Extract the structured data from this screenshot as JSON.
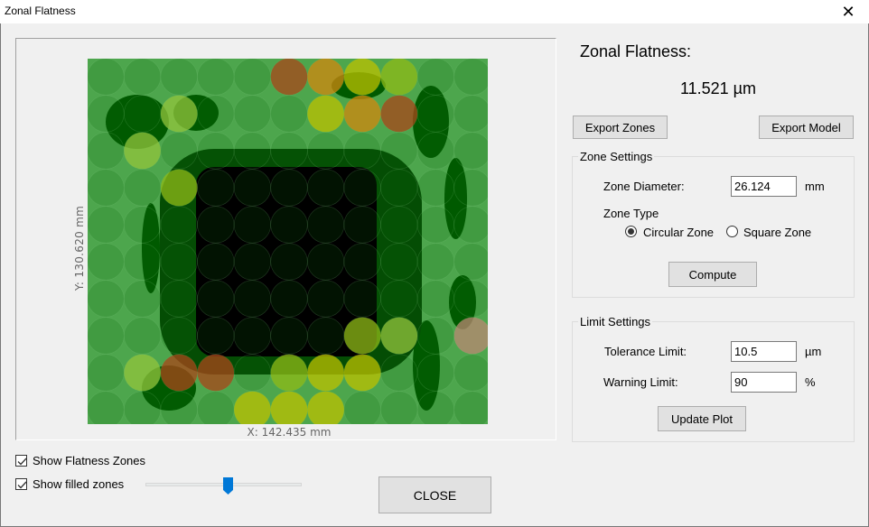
{
  "window": {
    "title": "Zonal Flatness",
    "close_glyph": "✕"
  },
  "plot": {
    "y_label": "Y:  130.620 mm",
    "x_label": "X:  142.435 mm",
    "colors": {
      "flat_light": "#4da64d",
      "flat_dark": "#005a00",
      "center": "#000000",
      "ok_zone": "#0a5f0a",
      "near_warning_zone": "#9acd32",
      "warning_zone": "#c8c800",
      "over_tolerance_zone": "#d2691e",
      "pink_zone": "#d48a8a"
    },
    "zones": [
      {
        "col": 6,
        "row": 1,
        "status": "red"
      },
      {
        "col": 7,
        "row": 1,
        "status": "orange"
      },
      {
        "col": 8,
        "row": 1,
        "status": "yellow"
      },
      {
        "col": 9,
        "row": 1,
        "status": "yellowgreen"
      },
      {
        "col": 3,
        "row": 2,
        "status": "lightgreen"
      },
      {
        "col": 7,
        "row": 2,
        "status": "yellow"
      },
      {
        "col": 8,
        "row": 2,
        "status": "orange"
      },
      {
        "col": 9,
        "row": 2,
        "status": "red"
      },
      {
        "col": 2,
        "row": 3,
        "status": "lightgreen"
      },
      {
        "col": 3,
        "row": 4,
        "status": "yellowgreen"
      },
      {
        "col": 8,
        "row": 8,
        "status": "yellowgreen"
      },
      {
        "col": 9,
        "row": 8,
        "status": "lightgreen"
      },
      {
        "col": 11,
        "row": 8,
        "status": "pink"
      },
      {
        "col": 2,
        "row": 9,
        "status": "lightgreen"
      },
      {
        "col": 3,
        "row": 9,
        "status": "red"
      },
      {
        "col": 4,
        "row": 9,
        "status": "red"
      },
      {
        "col": 6,
        "row": 9,
        "status": "yellowgreen"
      },
      {
        "col": 7,
        "row": 9,
        "status": "yellow"
      },
      {
        "col": 8,
        "row": 9,
        "status": "yellow"
      },
      {
        "col": 5,
        "row": 10,
        "status": "yellow"
      },
      {
        "col": 6,
        "row": 10,
        "status": "yellow"
      },
      {
        "col": 7,
        "row": 10,
        "status": "yellow"
      }
    ]
  },
  "results": {
    "heading": "Zonal Flatness:",
    "value": "11.521 µm"
  },
  "buttons": {
    "export_zones": "Export Zones",
    "export_model": "Export Model",
    "compute": "Compute",
    "update_plot": "Update Plot",
    "close": "CLOSE"
  },
  "zone_settings": {
    "legend": "Zone Settings",
    "diameter_label": "Zone Diameter:",
    "diameter_value": "26.124",
    "diameter_unit": "mm",
    "type_label": "Zone Type",
    "options": [
      {
        "label": "Circular Zone",
        "selected": true
      },
      {
        "label": "Square Zone",
        "selected": false
      }
    ]
  },
  "limit_settings": {
    "legend": "Limit Settings",
    "tolerance_label": "Tolerance Limit:",
    "tolerance_value": "10.5",
    "tolerance_unit": "µm",
    "warning_label": "Warning Limit:",
    "warning_value": "90",
    "warning_unit": "%"
  },
  "options": {
    "show_flatness_zones": {
      "label": "Show Flatness Zones",
      "checked": true
    },
    "show_filled_zones": {
      "label": "Show filled zones",
      "checked": true
    },
    "fill_opacity_slider": {
      "value_fraction": 0.53,
      "color": "#0078d7"
    }
  }
}
